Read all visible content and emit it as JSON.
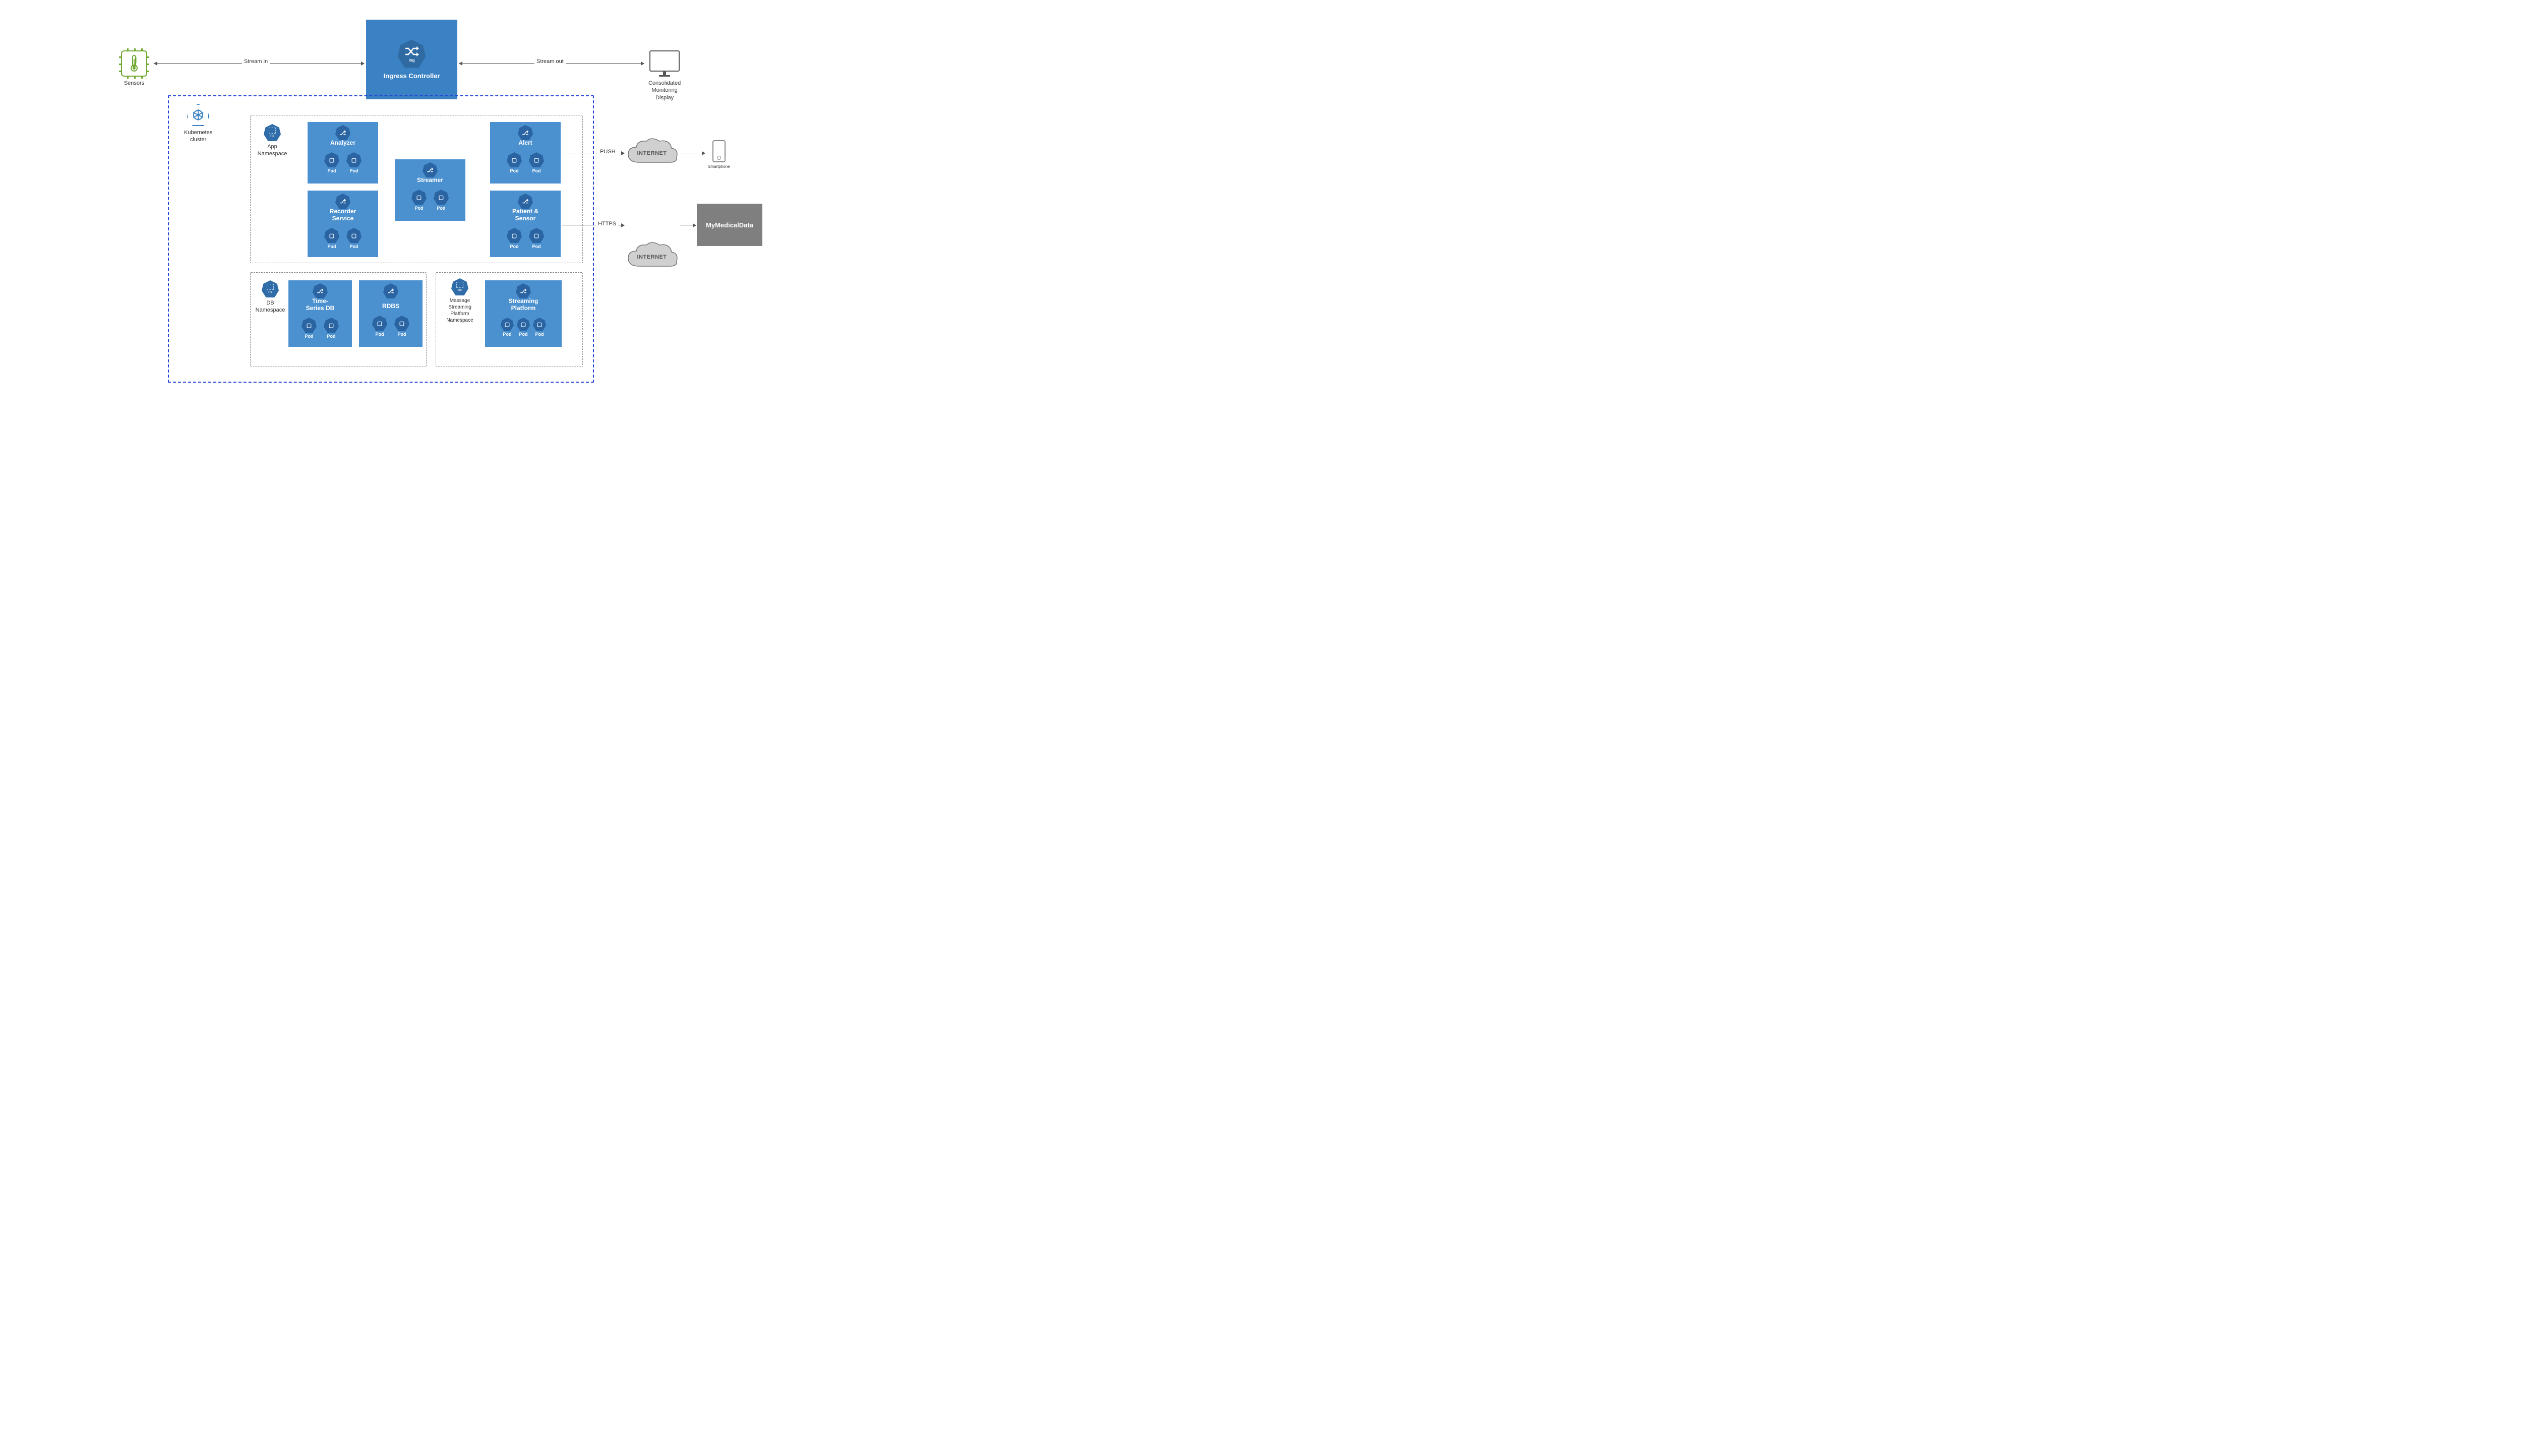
{
  "external": {
    "sensors_label": "Sensors",
    "monitor_label": "Consolidated\nMonitoring\nDisplay",
    "smartphone_label": "Smartphone",
    "mymedical_label": "MyMedicalData",
    "internet_label": "INTERNET"
  },
  "ingress": {
    "title": "Ingress Controller",
    "badge": "ing"
  },
  "cluster": {
    "label": "Kubernetes\ncluster"
  },
  "namespaces": {
    "app": {
      "label": "App\nNamespace",
      "badge": "ns"
    },
    "db": {
      "label": "DB\nNamespace",
      "badge": "ns"
    },
    "msg": {
      "label": "Massage\nStreaming\nPlatform\nNamespace",
      "badge": "ns"
    }
  },
  "services": {
    "analyzer": {
      "title": "Analyzer",
      "pods": [
        "Pod",
        "Pod"
      ]
    },
    "recorder": {
      "title": "Recorder\nService",
      "pods": [
        "Pod",
        "Pod"
      ]
    },
    "streamer": {
      "title": "Streamer",
      "pods": [
        "Pod",
        "Pod"
      ]
    },
    "alert": {
      "title": "Alert",
      "pods": [
        "Pod",
        "Pod"
      ]
    },
    "patient": {
      "title": "Patient &\nSensor",
      "pods": [
        "Pod",
        "Pod"
      ]
    },
    "tsdb": {
      "title": "Time-\nSeries DB",
      "pods": [
        "Pod",
        "Pod"
      ]
    },
    "rdbs": {
      "title": "RDBS",
      "pods": [
        "Pod",
        "Pod"
      ]
    },
    "streaming": {
      "title": "Streaming\nPlatform",
      "pods": [
        "Pod",
        "Pod",
        "Pod"
      ]
    }
  },
  "pod_badge": "pod",
  "edges": {
    "stream_in": "Stream in",
    "stream_out": "Stream out",
    "push": "PUSH",
    "https": "HTTPS"
  }
}
